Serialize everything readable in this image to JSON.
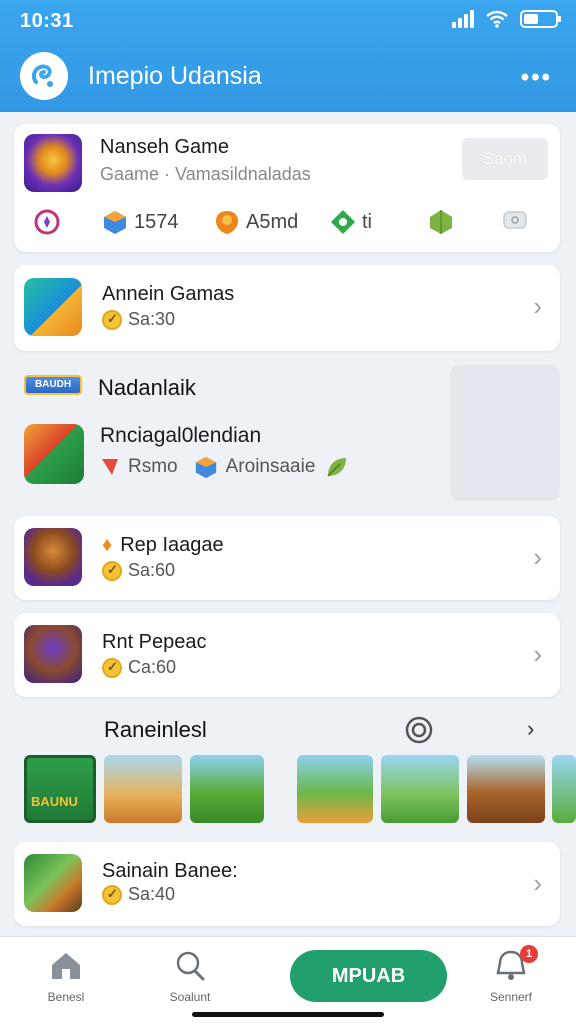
{
  "status": {
    "time": "10:31"
  },
  "header": {
    "title": "Imepio Udansia",
    "more_label": "•••"
  },
  "top_card": {
    "title": "Nanseh Game",
    "subtitle": "Gaame · Vamasildnaladas",
    "save_label": "Saom",
    "stats": [
      {
        "icon": "compass-icon",
        "value": ""
      },
      {
        "icon": "cube-icon",
        "value": "1574"
      },
      {
        "icon": "shield-icon",
        "value": "A5md"
      },
      {
        "icon": "gem-icon",
        "value": "ti"
      },
      {
        "icon": "leaf-icon",
        "value": ""
      },
      {
        "icon": "chat-icon",
        "value": ""
      }
    ]
  },
  "list": [
    {
      "title": "Annein Gamas",
      "score": "Sa:30"
    },
    {
      "title": "Rep Iaagae",
      "score": "Sa:60"
    },
    {
      "title": "Rnt Pepeac",
      "score": "Ca:60"
    },
    {
      "title": "Sainain Banee:",
      "score": "Sa:40"
    }
  ],
  "featured": {
    "badge": "BAUDH",
    "section_title": "Nadanlaik",
    "title": "Rnciagal0lendian",
    "tag1": "Rsmo",
    "tag2": "Aroinsaaie"
  },
  "strip_section": {
    "title": "Raneinlesl"
  },
  "strip_first_label": "BAUNU",
  "bottom_nav": {
    "home": "Benesl",
    "search": "Soalunt",
    "cta": "MPUAB",
    "profile": "Sennerf",
    "badge_count": "1"
  },
  "colors": {
    "header": "#3aa6ee",
    "cta": "#22a06b",
    "badge": "#ea3b3b"
  }
}
